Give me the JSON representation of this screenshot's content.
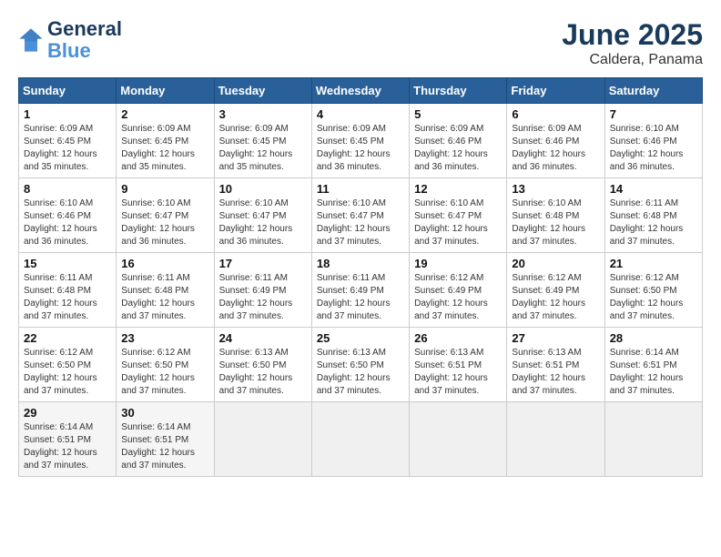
{
  "header": {
    "logo_line1": "General",
    "logo_line2": "Blue",
    "month": "June 2025",
    "location": "Caldera, Panama"
  },
  "weekdays": [
    "Sunday",
    "Monday",
    "Tuesday",
    "Wednesday",
    "Thursday",
    "Friday",
    "Saturday"
  ],
  "weeks": [
    [
      {
        "day": "1",
        "info": "Sunrise: 6:09 AM\nSunset: 6:45 PM\nDaylight: 12 hours\nand 35 minutes."
      },
      {
        "day": "2",
        "info": "Sunrise: 6:09 AM\nSunset: 6:45 PM\nDaylight: 12 hours\nand 35 minutes."
      },
      {
        "day": "3",
        "info": "Sunrise: 6:09 AM\nSunset: 6:45 PM\nDaylight: 12 hours\nand 35 minutes."
      },
      {
        "day": "4",
        "info": "Sunrise: 6:09 AM\nSunset: 6:45 PM\nDaylight: 12 hours\nand 36 minutes."
      },
      {
        "day": "5",
        "info": "Sunrise: 6:09 AM\nSunset: 6:46 PM\nDaylight: 12 hours\nand 36 minutes."
      },
      {
        "day": "6",
        "info": "Sunrise: 6:09 AM\nSunset: 6:46 PM\nDaylight: 12 hours\nand 36 minutes."
      },
      {
        "day": "7",
        "info": "Sunrise: 6:10 AM\nSunset: 6:46 PM\nDaylight: 12 hours\nand 36 minutes."
      }
    ],
    [
      {
        "day": "8",
        "info": "Sunrise: 6:10 AM\nSunset: 6:46 PM\nDaylight: 12 hours\nand 36 minutes."
      },
      {
        "day": "9",
        "info": "Sunrise: 6:10 AM\nSunset: 6:47 PM\nDaylight: 12 hours\nand 36 minutes."
      },
      {
        "day": "10",
        "info": "Sunrise: 6:10 AM\nSunset: 6:47 PM\nDaylight: 12 hours\nand 36 minutes."
      },
      {
        "day": "11",
        "info": "Sunrise: 6:10 AM\nSunset: 6:47 PM\nDaylight: 12 hours\nand 37 minutes."
      },
      {
        "day": "12",
        "info": "Sunrise: 6:10 AM\nSunset: 6:47 PM\nDaylight: 12 hours\nand 37 minutes."
      },
      {
        "day": "13",
        "info": "Sunrise: 6:10 AM\nSunset: 6:48 PM\nDaylight: 12 hours\nand 37 minutes."
      },
      {
        "day": "14",
        "info": "Sunrise: 6:11 AM\nSunset: 6:48 PM\nDaylight: 12 hours\nand 37 minutes."
      }
    ],
    [
      {
        "day": "15",
        "info": "Sunrise: 6:11 AM\nSunset: 6:48 PM\nDaylight: 12 hours\nand 37 minutes."
      },
      {
        "day": "16",
        "info": "Sunrise: 6:11 AM\nSunset: 6:48 PM\nDaylight: 12 hours\nand 37 minutes."
      },
      {
        "day": "17",
        "info": "Sunrise: 6:11 AM\nSunset: 6:49 PM\nDaylight: 12 hours\nand 37 minutes."
      },
      {
        "day": "18",
        "info": "Sunrise: 6:11 AM\nSunset: 6:49 PM\nDaylight: 12 hours\nand 37 minutes."
      },
      {
        "day": "19",
        "info": "Sunrise: 6:12 AM\nSunset: 6:49 PM\nDaylight: 12 hours\nand 37 minutes."
      },
      {
        "day": "20",
        "info": "Sunrise: 6:12 AM\nSunset: 6:49 PM\nDaylight: 12 hours\nand 37 minutes."
      },
      {
        "day": "21",
        "info": "Sunrise: 6:12 AM\nSunset: 6:50 PM\nDaylight: 12 hours\nand 37 minutes."
      }
    ],
    [
      {
        "day": "22",
        "info": "Sunrise: 6:12 AM\nSunset: 6:50 PM\nDaylight: 12 hours\nand 37 minutes."
      },
      {
        "day": "23",
        "info": "Sunrise: 6:12 AM\nSunset: 6:50 PM\nDaylight: 12 hours\nand 37 minutes."
      },
      {
        "day": "24",
        "info": "Sunrise: 6:13 AM\nSunset: 6:50 PM\nDaylight: 12 hours\nand 37 minutes."
      },
      {
        "day": "25",
        "info": "Sunrise: 6:13 AM\nSunset: 6:50 PM\nDaylight: 12 hours\nand 37 minutes."
      },
      {
        "day": "26",
        "info": "Sunrise: 6:13 AM\nSunset: 6:51 PM\nDaylight: 12 hours\nand 37 minutes."
      },
      {
        "day": "27",
        "info": "Sunrise: 6:13 AM\nSunset: 6:51 PM\nDaylight: 12 hours\nand 37 minutes."
      },
      {
        "day": "28",
        "info": "Sunrise: 6:14 AM\nSunset: 6:51 PM\nDaylight: 12 hours\nand 37 minutes."
      }
    ],
    [
      {
        "day": "29",
        "info": "Sunrise: 6:14 AM\nSunset: 6:51 PM\nDaylight: 12 hours\nand 37 minutes."
      },
      {
        "day": "30",
        "info": "Sunrise: 6:14 AM\nSunset: 6:51 PM\nDaylight: 12 hours\nand 37 minutes."
      },
      {
        "day": "",
        "info": ""
      },
      {
        "day": "",
        "info": ""
      },
      {
        "day": "",
        "info": ""
      },
      {
        "day": "",
        "info": ""
      },
      {
        "day": "",
        "info": ""
      }
    ]
  ]
}
